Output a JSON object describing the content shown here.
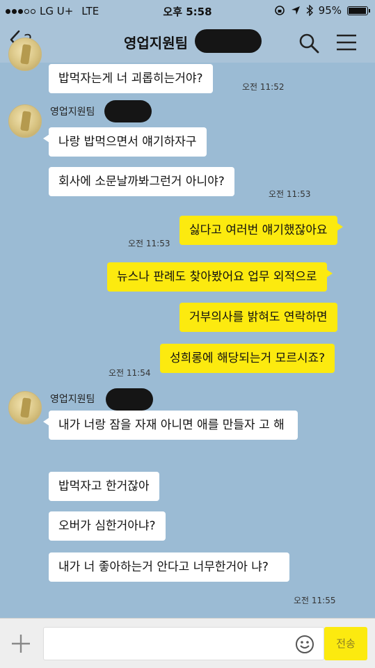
{
  "status_bar": {
    "carrier": "LG U+",
    "network": "LTE",
    "time": "오후 5:58",
    "battery": "95%",
    "battery_fraction": 0.95
  },
  "header": {
    "back_count": "2",
    "title": "영업지원팀"
  },
  "messages": {
    "m0": {
      "text": "밥먹자는게 너 괴롭히는거야?",
      "time": "오전 11:52"
    },
    "g1": {
      "sender": "영업지원팀"
    },
    "m1": {
      "text": "나랑 밥먹으면서 얘기하자구"
    },
    "m2": {
      "text": "회사에 소문날까봐그런거 아니야?",
      "time": "오전 11:53"
    },
    "m3": {
      "text": "싫다고 여러번 얘기했잖아요",
      "time": "오전 11:53"
    },
    "m4": {
      "text": "뉴스나 판례도 찾아봤어요 업무 외적으로"
    },
    "m5": {
      "text": "거부의사를 밝혀도 연락하면"
    },
    "m6": {
      "text": "성희롱에 해당되는거 모르시죠?",
      "time": "오전 11:54"
    },
    "g2": {
      "sender": "영업지원팀"
    },
    "m7": {
      "text": "내가 너랑 잠을 자재 아니면 애를 만들자 고 해"
    },
    "m8": {
      "text": "밥먹자고 한거잖아"
    },
    "m9": {
      "text": "오버가 심한거아냐?"
    },
    "m10": {
      "text": "내가 너 좋아하는거 안다고 너무한거아 냐?",
      "time": "오전 11:55"
    }
  },
  "input_bar": {
    "send_label": "전송"
  },
  "colors": {
    "chat_background": "#9bbbd4",
    "outgoing_bubble": "#fcea0f",
    "incoming_bubble": "#ffffff"
  },
  "icons": [
    "back-chevron-icon",
    "search-icon",
    "menu-icon",
    "plus-icon",
    "emoji-icon",
    "location-arrow-icon",
    "bluetooth-icon",
    "battery-icon"
  ]
}
